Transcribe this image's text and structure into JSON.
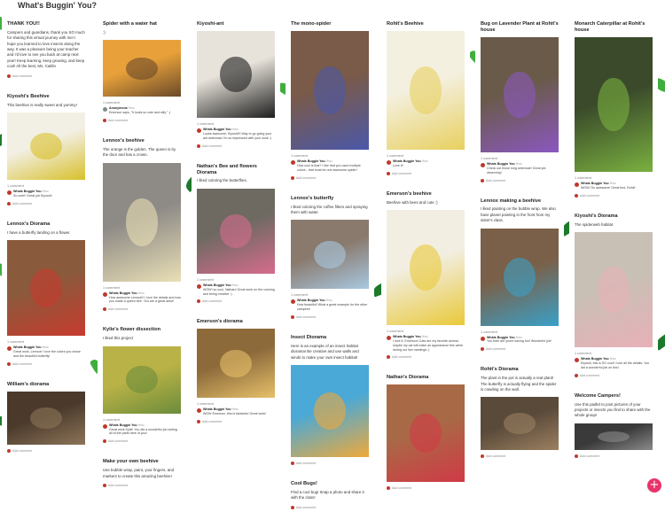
{
  "page": {
    "title": "What's Buggin' You?"
  },
  "colors": {
    "accent": "#e8336b",
    "leaf_green": "#3fae3f",
    "leaf_dark": "#1d7a2c"
  },
  "labels": {
    "add_comment": "Add comment"
  },
  "columns": [
    [
      {
        "title": "THANK YOU!!",
        "body": "Campers and guardians, thank you SO much for sharing this virtual journey with me! I hope you learned to love insects along the way. It was a pleasure being your teacher and I'd love to see you back at camp next year! Keep learning, keep growing, and keep cool! All the best, Ms. Caitlin",
        "img": null,
        "comments_count": "",
        "comments": []
      },
      {
        "title": "Kiyoshi's Beehive",
        "body": "This beehive is really sweet and yummy!",
        "img": {
          "h": 76,
          "bg": "#f2efe4",
          "fg": "#d8c02a"
        },
        "comments_count": "1 comment",
        "comments": [
          {
            "name": "Whats Buggin You",
            "time": "9mo",
            "text": "So cute!! Great job Kiyoshi!",
            "avatar": "red"
          }
        ]
      },
      {
        "title": "Lennox's Diorama",
        "body": "I have a butterfly landing on a flower.",
        "img": {
          "h": 108,
          "bg": "#8a5a3c",
          "fg": "#c73b2e"
        },
        "comments_count": "1 comment",
        "comments": [
          {
            "name": "Whats Buggin You",
            "time": "9mo",
            "text": "Great work, Lennox! I love the colors you chose and the beautiful butterfly!",
            "avatar": "red"
          }
        ]
      },
      {
        "title": "William's diorama",
        "body": "",
        "img": {
          "h": 60,
          "bg": "#4b3a2c",
          "fg": "#8c7458"
        },
        "comments_count": "",
        "comments": []
      }
    ],
    [
      {
        "title": "Spider with a water hat",
        "body": ":)",
        "img": {
          "h": 64,
          "bg": "#e8a13a",
          "fg": "#6a4a2a"
        },
        "comments_count": "1 comment",
        "comments": [
          {
            "name": "Anonymous",
            "time": "9mo",
            "text": "Emerson says, \"It looks so cute and silly.\" :)",
            "avatar": "gray"
          }
        ]
      },
      {
        "title": "Lennox's beehive",
        "body": "The orange is the golden. The queen is by the door and has a crown.",
        "img": {
          "h": 134,
          "bg": "#8e8a86",
          "fg": "#e9dfb6"
        },
        "comments_count": "1 comment",
        "comments": [
          {
            "name": "Whats Buggin You",
            "time": "9mo",
            "text": "How awesome Lennox!!! I love the details and how you made a queen bee. You are a great artist!",
            "avatar": "red"
          }
        ]
      },
      {
        "title": "Kylie's flower dissection",
        "body": "I liked this project",
        "img": {
          "h": 76,
          "bg": "#b9b246",
          "fg": "#6c8c3b"
        },
        "comments_count": "1 comment",
        "comments": [
          {
            "name": "Whats Buggin You",
            "time": "9mo",
            "text": "Great work Kylie! You did a wonderful job writing all of the parts here of your",
            "avatar": "red"
          }
        ]
      },
      {
        "title": "Make your own beehive",
        "body": "Use bubble wrap, paint, your fingers, and markers to create this amazing beehive!",
        "img": null,
        "comments_count": "",
        "comments": []
      }
    ],
    [
      {
        "title": "Kiyoshi-ant",
        "body": "",
        "img": {
          "h": 98,
          "bg": "#e7e2da",
          "fg": "#1e1e1e"
        },
        "comments_count": "1 comment",
        "comments": [
          {
            "name": "Whats Buggin You",
            "time": "9mo",
            "text": "Looks awesome, Kiyoshi!!! Way to go going your ant antennas! I'm so impressed with your work :)",
            "avatar": "red"
          }
        ]
      },
      {
        "title": "Nathan's Bee and flowers Diorama",
        "body": "I liked coloring the butterflies.",
        "img": {
          "h": 96,
          "bg": "#6e6a62",
          "fg": "#d66c8d"
        },
        "comments_count": "1 comment",
        "comments": [
          {
            "name": "Whats Buggin You",
            "time": "9mo",
            "text": "WOW! so cool, Nathan! Great work on the coloring and being creative :)",
            "avatar": "red"
          }
        ]
      },
      {
        "title": "Emerson's diorama",
        "body": "",
        "img": {
          "h": 78,
          "bg": "#8c6a3a",
          "fg": "#e6c06a"
        },
        "comments_count": "1 comment",
        "comments": [
          {
            "name": "Whats Buggin You",
            "time": "9mo",
            "text": "WOW Emerson, this is fantastic! Great work!",
            "avatar": "red"
          }
        ]
      }
    ],
    [
      {
        "title": "The mono-spider",
        "body": "",
        "img": {
          "h": 134,
          "bg": "#7a5a48",
          "fg": "#4b58a8"
        },
        "comments_count": "1 comment",
        "comments": [
          {
            "name": "Whats Buggin You",
            "time": "9mo",
            "text": "How cool is that? I like that you used multiple colors - that must be one awesome spider!",
            "avatar": "red"
          }
        ]
      },
      {
        "title": "Lennox's butterfly",
        "body": "I liked coloring the coffee filters and spraying them with water.",
        "img": {
          "h": 78,
          "bg": "#8a7a6e",
          "fg": "#a8c8e0"
        },
        "comments_count": "1 comment",
        "comments": [
          {
            "name": "Whats Buggin You",
            "time": "9mo",
            "text": "How beautiful! What a great example for the other campers!",
            "avatar": "red"
          }
        ]
      },
      {
        "title": "Insect Diorama",
        "body": "Here is an example of an insect habitat diorama! Be creative and use walls and winds to make your own insect habitat!",
        "img": {
          "h": 104,
          "bg": "#4aa9d6",
          "fg": "#f0a93a"
        },
        "comments_count": "",
        "comments": []
      },
      {
        "title": "Cool Bugs!",
        "body": "Find a cool bug! Snap a photo and share it with the class!",
        "img": null,
        "comments_count": "",
        "comments": []
      }
    ],
    [
      {
        "title": "Rohit's Beehive",
        "body": "",
        "img": {
          "h": 134,
          "bg": "#f4f0e0",
          "fg": "#e8d060"
        },
        "comments_count": "1 comment",
        "comments": [
          {
            "name": "Whats Buggin You",
            "time": "9mo",
            "text": "Love it!",
            "avatar": "red"
          }
        ]
      },
      {
        "title": "Emerson's beehive",
        "body": "Beehive with bees and cute :)",
        "img": {
          "h": 130,
          "bg": "#f2eee2",
          "fg": "#e9c93a"
        },
        "comments_count": "1 comment",
        "comments": [
          {
            "name": "Whats Buggin You",
            "time": "9mo",
            "text": "I love it, Emerson! Cats are my favorite animal, maybe my cat will make an appearance this week during our live meetings :)",
            "avatar": "red"
          }
        ]
      },
      {
        "title": "Nathan's Diorama",
        "body": "",
        "img": {
          "h": 110,
          "bg": "#a86a46",
          "fg": "#d03a46"
        },
        "comments_count": "",
        "comments": []
      }
    ],
    [
      {
        "title": "Bug on Lavender Plant at Rohit's house",
        "body": "",
        "img": {
          "h": 130,
          "bg": "#6a5a4a",
          "fg": "#8a58c0"
        },
        "comments_count": "1 comment",
        "comments": [
          {
            "name": "Whats Buggin You",
            "time": "9mo",
            "text": "Check out those long antennae! Great job observing!",
            "avatar": "red"
          }
        ]
      },
      {
        "title": "Lennox making a beehive",
        "body": "I liked painting on the bubble wrap. We also have planet painting in the front from my sister's class.",
        "img": {
          "h": 110,
          "bg": "#7a6048",
          "fg": "#3aa0c8"
        },
        "comments_count": "1 comment",
        "comments": [
          {
            "name": "Whats Buggin You",
            "time": "9mo",
            "text": "You both are youre having fun! Wonderful job!",
            "avatar": "red"
          }
        ]
      },
      {
        "title": "Rohit's Diorama",
        "body": "The plant in the pot is actually a real plant! The butterfly is actually flying and the spider is crawling on the wall.",
        "img": {
          "h": 60,
          "bg": "#5a4a3a",
          "fg": "#9a8060"
        },
        "comments_count": "",
        "comments": []
      }
    ],
    [
      {
        "title": "Monarch Caterpillar at Rohit's house",
        "body": "",
        "img": {
          "h": 152,
          "bg": "#3a4a2a",
          "fg": "#7ab040"
        },
        "comments_count": "1 comment",
        "comments": [
          {
            "name": "Whats Buggin You",
            "time": "9mo",
            "text": "WOW! So awesome! Great find, Rohit!",
            "avatar": "red"
          }
        ]
      },
      {
        "title": "Kiyoshi's Diorama",
        "body": "The spiderweb habitat",
        "img": {
          "h": 130,
          "bg": "#c8c0b4",
          "fg": "#e8b0b8"
        },
        "comments_count": "1 comment",
        "comments": [
          {
            "name": "Whats Buggin You",
            "time": "9mo",
            "text": "Kiyoshi, this is SO cool! I love all the details. You did a wonderful job on this!",
            "avatar": "red"
          }
        ]
      },
      {
        "title": "Welcome Campers!",
        "body": "Use this padlet to post pictures of your projects or insects you find to share with the whole group!",
        "img": {
          "h": 30,
          "bg": "#3a3a3a",
          "fg": "#8a8a8a"
        },
        "comments_count": "",
        "comments": []
      }
    ]
  ]
}
